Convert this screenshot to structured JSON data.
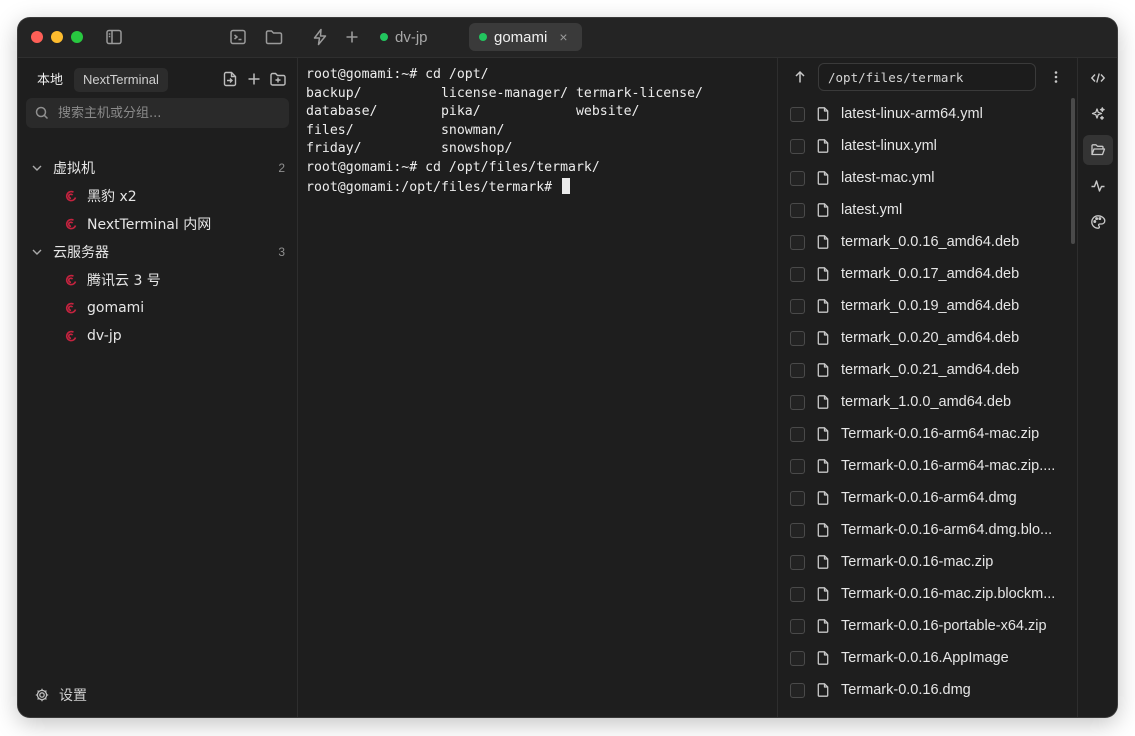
{
  "titlebar": {
    "tabs": [
      {
        "label": "dv-jp",
        "active": false
      },
      {
        "label": "gomami",
        "active": true,
        "close": "×"
      }
    ]
  },
  "sidebar": {
    "tabs": [
      {
        "label": "本地"
      },
      {
        "label": "NextTerminal"
      }
    ],
    "search_placeholder": "搜索主机或分组...",
    "groups": [
      {
        "name": "虚拟机",
        "count": "2",
        "hosts": [
          {
            "name": "黑豹 x2"
          },
          {
            "name": "NextTerminal 内网"
          }
        ]
      },
      {
        "name": "云服务器",
        "count": "3",
        "hosts": [
          {
            "name": "腾讯云 3 号"
          },
          {
            "name": "gomami"
          },
          {
            "name": "dv-jp"
          }
        ]
      }
    ],
    "settings_label": "设置"
  },
  "terminal": {
    "lines": [
      "root@gomami:~# cd /opt/",
      "backup/          license-manager/ termark-license/",
      "database/        pika/            website/",
      "files/           snowman/",
      "friday/          snowshop/",
      "root@gomami:~# cd /opt/files/termark/",
      "root@gomami:/opt/files/termark# "
    ]
  },
  "files": {
    "path": "/opt/files/termark",
    "items": [
      "latest-linux-arm64.yml",
      "latest-linux.yml",
      "latest-mac.yml",
      "latest.yml",
      "termark_0.0.16_amd64.deb",
      "termark_0.0.17_amd64.deb",
      "termark_0.0.19_amd64.deb",
      "termark_0.0.20_amd64.deb",
      "termark_0.0.21_amd64.deb",
      "termark_1.0.0_amd64.deb",
      "Termark-0.0.16-arm64-mac.zip",
      "Termark-0.0.16-arm64-mac.zip....",
      "Termark-0.0.16-arm64.dmg",
      "Termark-0.0.16-arm64.dmg.blo...",
      "Termark-0.0.16-mac.zip",
      "Termark-0.0.16-mac.zip.blockm...",
      "Termark-0.0.16-portable-x64.zip",
      "Termark-0.0.16.AppImage",
      "Termark-0.0.16.dmg"
    ]
  },
  "rail": {
    "buttons": [
      "code-icon",
      "sparkles-icon",
      "folder-open-icon",
      "activity-icon",
      "palette-icon"
    ],
    "active": "folder-open-icon"
  },
  "colors": {
    "window_bg": "#1e1e1e",
    "titlebar_bg": "#242424",
    "active_tab_bg": "#3a3a3a",
    "online_dot": "#22c55e",
    "debian_red": "#c5233f"
  }
}
